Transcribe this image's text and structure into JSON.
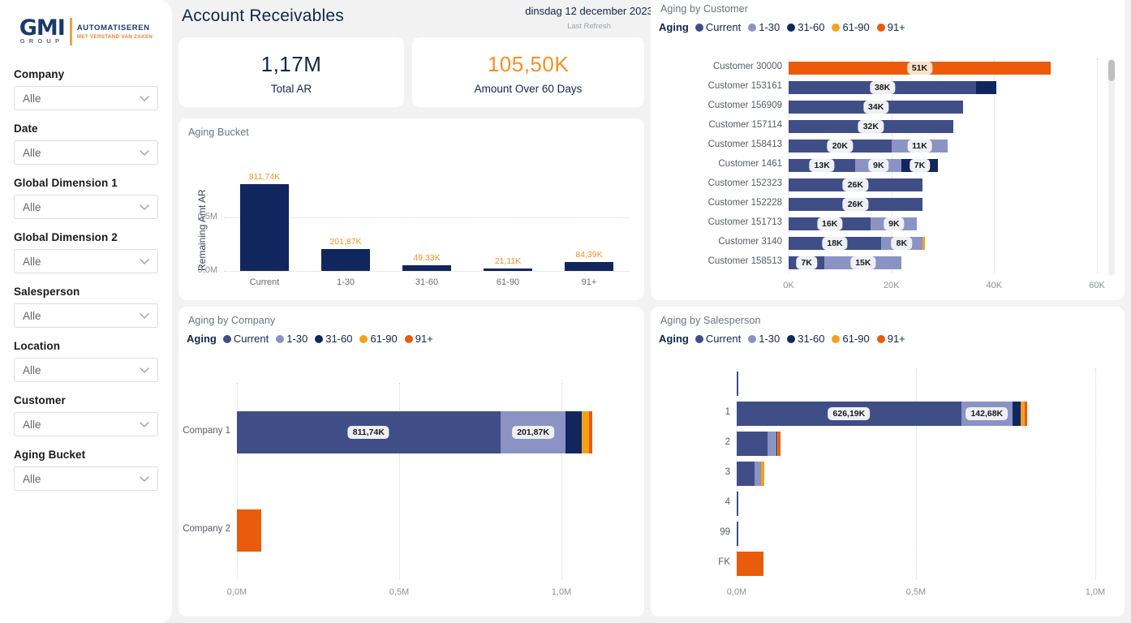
{
  "brand": {
    "logo_main": "GMI",
    "logo_sub": "GROUP",
    "logo_right_top": "AUTOMATISEREN",
    "logo_right_bottom": "MET VERSTAND VAN ZAKEN",
    "navy": "#1b3a6b",
    "orange": "#e8842a"
  },
  "sidebar": {
    "filters": [
      {
        "label": "Company",
        "value": "Alle"
      },
      {
        "label": "Date",
        "value": "Alle"
      },
      {
        "label": "Global Dimension 1",
        "value": "Alle"
      },
      {
        "label": "Global Dimension 2",
        "value": "Alle"
      },
      {
        "label": "Salesperson",
        "value": "Alle"
      },
      {
        "label": "Location",
        "value": "Alle"
      },
      {
        "label": "Customer",
        "value": "Alle"
      },
      {
        "label": "Aging Bucket",
        "value": "Alle"
      }
    ]
  },
  "header": {
    "title": "Account Receivables",
    "date": "dinsdag 12 december 2023",
    "date_caption": "Last Refresh"
  },
  "kpis": [
    {
      "value": "1,17M",
      "caption": "Total AR",
      "color": "#12264a"
    },
    {
      "value": "105,50K",
      "caption": "Amount Over 60 Days",
      "color": "#f29221"
    }
  ],
  "legend": {
    "title": "Aging",
    "items": [
      {
        "label": "Current",
        "color": "#3f4e86"
      },
      {
        "label": "1-30",
        "color": "#8a93c4"
      },
      {
        "label": "31-60",
        "color": "#12265e"
      },
      {
        "label": "61-90",
        "color": "#f5a01d"
      },
      {
        "label": "91+",
        "color": "#ea5b0c"
      }
    ]
  },
  "chart_data": [
    {
      "id": "aging_bucket",
      "type": "bar",
      "title": "Aging Bucket",
      "xlabel": "",
      "ylabel": "Remaining Amt AR",
      "categories": [
        "Current",
        "1-30",
        "31-60",
        "61-90",
        "91+"
      ],
      "values": [
        811740,
        201870,
        49330,
        21110,
        84390
      ],
      "data_labels": [
        "811,74K",
        "201,87K",
        "49,33K",
        "21,11K",
        "84,39K"
      ],
      "ylim": [
        0,
        1000000
      ],
      "yticks": [
        0,
        500000
      ],
      "ytick_labels": [
        "0,0M",
        "0,5M"
      ],
      "grid": true,
      "bar_color": "#12265e",
      "label_color": "#f29221"
    },
    {
      "id": "aging_by_customer",
      "type": "bar",
      "orientation": "horizontal",
      "stacked": true,
      "title": "Aging by Customer",
      "categories": [
        "Customer 30000",
        "Customer 153161",
        "Customer 156909",
        "Customer 157114",
        "Customer 158413",
        "Customer 1461",
        "Customer 152323",
        "Customer 152228",
        "Customer 151713",
        "Customer 3140",
        "Customer 158513"
      ],
      "series": [
        {
          "name": "Current",
          "values": [
            0,
            36500,
            34000,
            32000,
            20000,
            13000,
            26000,
            26000,
            16000,
            18000,
            7000
          ]
        },
        {
          "name": "1-30",
          "values": [
            0,
            0,
            0,
            0,
            11000,
            9000,
            0,
            0,
            9000,
            8000,
            15000
          ]
        },
        {
          "name": "31-60",
          "values": [
            0,
            4000,
            0,
            0,
            0,
            7000,
            0,
            0,
            0,
            0,
            0
          ]
        },
        {
          "name": "61-90",
          "values": [
            0,
            0,
            0,
            0,
            0,
            0,
            0,
            0,
            0,
            600,
            0
          ]
        },
        {
          "name": "91+",
          "values": [
            51000,
            0,
            0,
            0,
            0,
            0,
            0,
            0,
            0,
            0,
            0
          ]
        }
      ],
      "data_labels": [
        [
          "51K"
        ],
        [
          "38K"
        ],
        [
          "34K"
        ],
        [
          "32K"
        ],
        [
          "20K",
          "11K"
        ],
        [
          "13K",
          "9K",
          "7K"
        ],
        [
          "26K"
        ],
        [
          "26K"
        ],
        [
          "16K",
          "9K"
        ],
        [
          "18K",
          "8K"
        ],
        [
          "7K",
          "15K"
        ]
      ],
      "xlim": [
        0,
        60000
      ],
      "xticks": [
        0,
        20000,
        40000,
        60000
      ],
      "xtick_labels": [
        "0K",
        "20K",
        "40K",
        "60K"
      ],
      "grid": true,
      "scrollbar": true
    },
    {
      "id": "aging_by_company",
      "type": "bar",
      "orientation": "horizontal",
      "stacked": true,
      "title": "Aging by Company",
      "categories": [
        "Company 1",
        "Company 2"
      ],
      "series": [
        {
          "name": "Current",
          "values": [
            811740,
            0
          ]
        },
        {
          "name": "1-30",
          "values": [
            201870,
            0
          ]
        },
        {
          "name": "31-60",
          "values": [
            49330,
            0
          ]
        },
        {
          "name": "61-90",
          "values": [
            21110,
            0
          ]
        },
        {
          "name": "91+",
          "values": [
            10000,
            74390
          ]
        }
      ],
      "data_labels": [
        [
          "811,74K",
          "201,87K"
        ],
        []
      ],
      "xlim": [
        0,
        1180000
      ],
      "xticks": [
        0,
        500000,
        1000000
      ],
      "xtick_labels": [
        "0,0M",
        "0,5M",
        "1,0M"
      ],
      "grid": true
    },
    {
      "id": "aging_by_salesperson",
      "type": "bar",
      "orientation": "horizontal",
      "stacked": true,
      "title": "Aging by Salesperson",
      "categories": [
        "",
        "1",
        "2",
        "3",
        "4",
        "99",
        "FK"
      ],
      "series": [
        {
          "name": "Current",
          "values": [
            1500,
            626190,
            86000,
            50000,
            1000,
            700,
            0
          ]
        },
        {
          "name": "1-30",
          "values": [
            0,
            142680,
            24000,
            17000,
            0,
            0,
            0
          ]
        },
        {
          "name": "31-60",
          "values": [
            0,
            22000,
            3000,
            2000,
            0,
            0,
            0
          ]
        },
        {
          "name": "61-90",
          "values": [
            0,
            13000,
            2000,
            7000,
            0,
            0,
            0
          ]
        },
        {
          "name": "91+",
          "values": [
            0,
            6000,
            7000,
            0,
            0,
            0,
            74390
          ]
        }
      ],
      "data_labels": [
        [],
        [
          "626,19K",
          "142,68K"
        ],
        [],
        [],
        [],
        [],
        []
      ],
      "xlim": [
        0,
        1000000
      ],
      "xticks": [
        0,
        500000,
        1000000
      ],
      "xtick_labels": [
        "0,0M",
        "0,5M",
        "1,0M"
      ],
      "grid": true
    }
  ]
}
